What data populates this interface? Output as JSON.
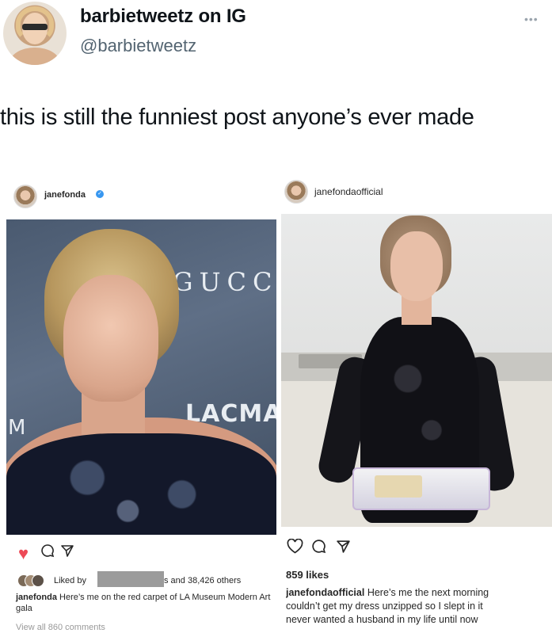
{
  "tweet": {
    "display_name": "barbietweetz on IG",
    "handle": "@barbietweetz",
    "more_icon": "more-dots-icon",
    "text": "this is still the funniest post anyone’s ever made"
  },
  "left_post": {
    "username": "janefonda",
    "verified_icon": "verified-check-icon",
    "photo_text_gucci": "GUCC",
    "photo_text_lacma": "LACMA",
    "photo_text_m": "M",
    "liked_by_label": "Liked by",
    "liked_others_text": "s and 38,426 others",
    "caption_user": "janefonda",
    "caption_text": "Here’s me on the red carpet of LA Museum Modern Art gala",
    "view_comments": "View all 860 comments",
    "heart_icon": "heart-filled-icon",
    "comment_icon": "comment-icon",
    "share_icon": "share-icon",
    "heart_color": "#ed4956"
  },
  "right_post": {
    "username": "janefondaofficial",
    "likes": "859 likes",
    "caption_user": "janefondaofficial",
    "caption_line1": "Here’s me the next morning",
    "caption_line2": "couldn’t get my dress unzipped so I slept in it",
    "caption_line3": "never wanted a husband in my life until now",
    "heart_icon": "heart-outline-icon",
    "comment_icon": "comment-icon",
    "share_icon": "share-icon"
  }
}
